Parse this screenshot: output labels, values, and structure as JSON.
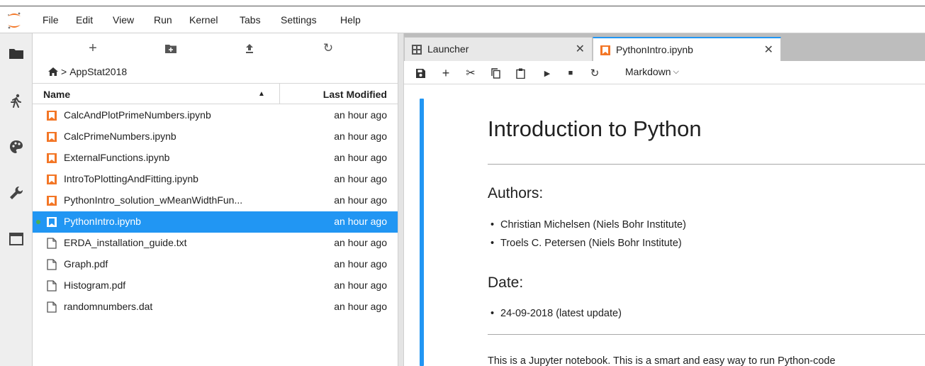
{
  "menu": [
    "File",
    "Edit",
    "View",
    "Run",
    "Kernel",
    "Tabs",
    "Settings",
    "Help"
  ],
  "breadcrumb": {
    "root": "",
    "path": "AppStat2018"
  },
  "file_browser": {
    "columns": {
      "name": "Name",
      "modified": "Last Modified"
    },
    "files": [
      {
        "name": "CalcAndPlotPrimeNumbers.ipynb",
        "modified": "an hour ago",
        "type": "notebook",
        "selected": false,
        "running": false
      },
      {
        "name": "CalcPrimeNumbers.ipynb",
        "modified": "an hour ago",
        "type": "notebook",
        "selected": false,
        "running": false
      },
      {
        "name": "ExternalFunctions.ipynb",
        "modified": "an hour ago",
        "type": "notebook",
        "selected": false,
        "running": false
      },
      {
        "name": "IntroToPlottingAndFitting.ipynb",
        "modified": "an hour ago",
        "type": "notebook",
        "selected": false,
        "running": false
      },
      {
        "name": "PythonIntro_solution_wMeanWidthFun...",
        "modified": "an hour ago",
        "type": "notebook",
        "selected": false,
        "running": false
      },
      {
        "name": "PythonIntro.ipynb",
        "modified": "an hour ago",
        "type": "notebook",
        "selected": true,
        "running": true
      },
      {
        "name": "ERDA_installation_guide.txt",
        "modified": "an hour ago",
        "type": "file",
        "selected": false,
        "running": false
      },
      {
        "name": "Graph.pdf",
        "modified": "an hour ago",
        "type": "file",
        "selected": false,
        "running": false
      },
      {
        "name": "Histogram.pdf",
        "modified": "an hour ago",
        "type": "file",
        "selected": false,
        "running": false
      },
      {
        "name": "randomnumbers.dat",
        "modified": "an hour ago",
        "type": "file",
        "selected": false,
        "running": false
      }
    ]
  },
  "tabs": [
    {
      "label": "Launcher",
      "icon": "launcher-icon",
      "active": false
    },
    {
      "label": "PythonIntro.ipynb",
      "icon": "notebook-icon",
      "active": true
    }
  ],
  "notebook_toolbar": {
    "cell_type": "Markdown"
  },
  "notebook": {
    "title": "Introduction to Python",
    "authors_heading": "Authors:",
    "authors": [
      "Christian Michelsen (Niels Bohr Institute)",
      "Troels C. Petersen (Niels Bohr Institute)"
    ],
    "date_heading": "Date:",
    "dates": [
      "24-09-2018 (latest update)"
    ],
    "intro": "This is a Jupyter notebook. This is a smart and easy way to run Python-code"
  },
  "colors": {
    "accent": "#2196f3",
    "notebook_orange": "#f37626",
    "running": "#4caf50"
  }
}
